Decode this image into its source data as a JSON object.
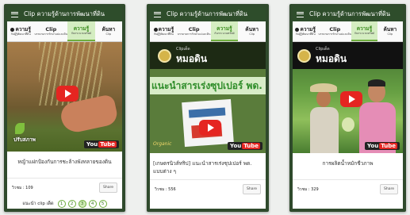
{
  "screens": [
    {
      "topbar_title": "Clip ความรู้ด้านการพัฒนาที่ดิน",
      "nav": [
        {
          "main": "ความรู้",
          "sub": "กับผู้รู้พัฒนาที่ดิน"
        },
        {
          "main": "Clip",
          "sub": "บรรยายการรักษาแม่และดิน"
        },
        {
          "main": "ความรู้",
          "sub": "กับกระบวนทรัพย์"
        },
        {
          "main": "ค้นหา",
          "sub": "Clip"
        }
      ],
      "video_overlay_text": "ปรับสภาพ",
      "youtube_label": "You",
      "youtube_label_tube": "Tube",
      "title": "หญ้าแฝกป้องกันการชะล้างพังทลายของดิน",
      "views": "วิวชม : 109",
      "share": "Share",
      "pagination_label": "แนะนำ clip เด็ด",
      "pages": [
        "1",
        "2",
        "3",
        "4",
        "5"
      ],
      "current_page": "3"
    },
    {
      "topbar_title": "Clip ความรู้ด้านการพัฒนาที่ดิน",
      "nav": [
        {
          "main": "ความรู้",
          "sub": "กับผู้รู้พัฒนาที่ดิน"
        },
        {
          "main": "Clip",
          "sub": "บรรยายการรักษาแม่และดิน"
        },
        {
          "main": "ความรู้",
          "sub": "กับกระบวนทรัพย์"
        },
        {
          "main": "ค้นหา",
          "sub": "Clip"
        }
      ],
      "brand_small": "Clipเด็ด",
      "brand_big": "หมอดิน",
      "banner": "แนะนำสารเร่งซุปเปอร์ พด.",
      "product_brand": "Organic",
      "youtube_label": "You",
      "youtube_label_tube": "Tube",
      "title": "[เกษตรนิวส์ทริป] แนะนำสารเร่งซุปเปอร์ พด. แบบต่าง ๆ",
      "views": "วิวชม : 556",
      "share": "Share"
    },
    {
      "topbar_title": "Clip ความรู้ด้านการพัฒนาที่ดิน",
      "nav": [
        {
          "main": "ความรู้",
          "sub": "กับผู้รู้พัฒนาที่ดิน"
        },
        {
          "main": "Clip",
          "sub": "บรรยายการรักษาแม่และดิน"
        },
        {
          "main": "ความรู้",
          "sub": "กับกระบวนทรัพย์"
        },
        {
          "main": "ค้นหา",
          "sub": "Clip"
        }
      ],
      "brand_small": "Clipเด็ด",
      "brand_big": "หมอดิน",
      "youtube_label": "You",
      "youtube_label_tube": "Tube",
      "title": "การผลิตน้ำหมักชีวภาพ",
      "views": "วิวชม : 329",
      "share": "Share"
    }
  ]
}
